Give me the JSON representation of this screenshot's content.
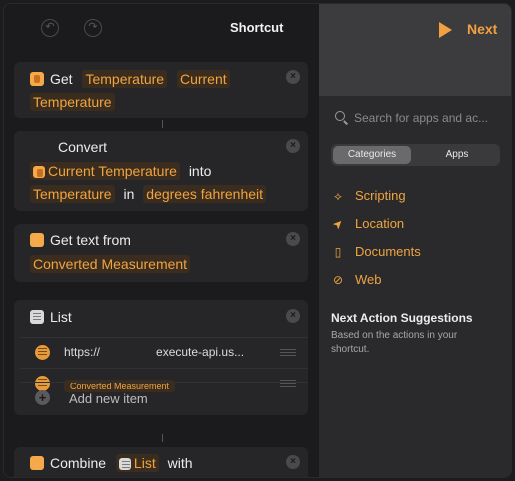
{
  "header": {
    "title": "Shortcut",
    "undo_glyph": "↶",
    "redo_glyph": "↷"
  },
  "actions": {
    "get": {
      "verb": "Get",
      "param": "Temperature",
      "var_line1": "Current",
      "var_line2": "Temperature",
      "delete_glyph": "×"
    },
    "convert": {
      "verb": "Convert",
      "input": "Current Temperature",
      "into": "into",
      "unit_type": "Temperature",
      "in": "in",
      "unit": "degrees fahrenheit",
      "delete_glyph": "×"
    },
    "get_text": {
      "verb": "Get text from",
      "input": "Converted Measurement",
      "delete_glyph": "×"
    },
    "list": {
      "verb": "List",
      "delete_glyph": "×",
      "items": [
        {
          "url_prefix": "https://",
          "url_suffix": "execute-api.us..."
        },
        {
          "chip": "Converted Measurement"
        }
      ],
      "add_label": "Add new item",
      "add_glyph": "+"
    },
    "combine": {
      "verb": "Combine",
      "input": "List",
      "with": "with",
      "delete_glyph": "×"
    }
  },
  "sidebar": {
    "next_label": "Next",
    "search": {
      "placeholder": "Search for apps and ac..."
    },
    "tabs": {
      "categories": "Categories",
      "apps": "Apps"
    },
    "categories": [
      {
        "label": "Scripting",
        "icon": "scripting-icon",
        "glyph": "⟡"
      },
      {
        "label": "Location",
        "icon": "location-arrow-icon",
        "glyph": "➤"
      },
      {
        "label": "Documents",
        "icon": "document-icon",
        "glyph": "▯"
      },
      {
        "label": "Web",
        "icon": "compass-icon",
        "glyph": "⊘"
      }
    ],
    "suggestions": {
      "title": "Next Action Suggestions",
      "subtitle": "Based on the actions in your shortcut."
    }
  },
  "colors": {
    "accent": "#f0a440",
    "token_bg": "#3a2d1f",
    "card_bg": "#262628",
    "sidebar_bg": "#2a2a2c"
  }
}
